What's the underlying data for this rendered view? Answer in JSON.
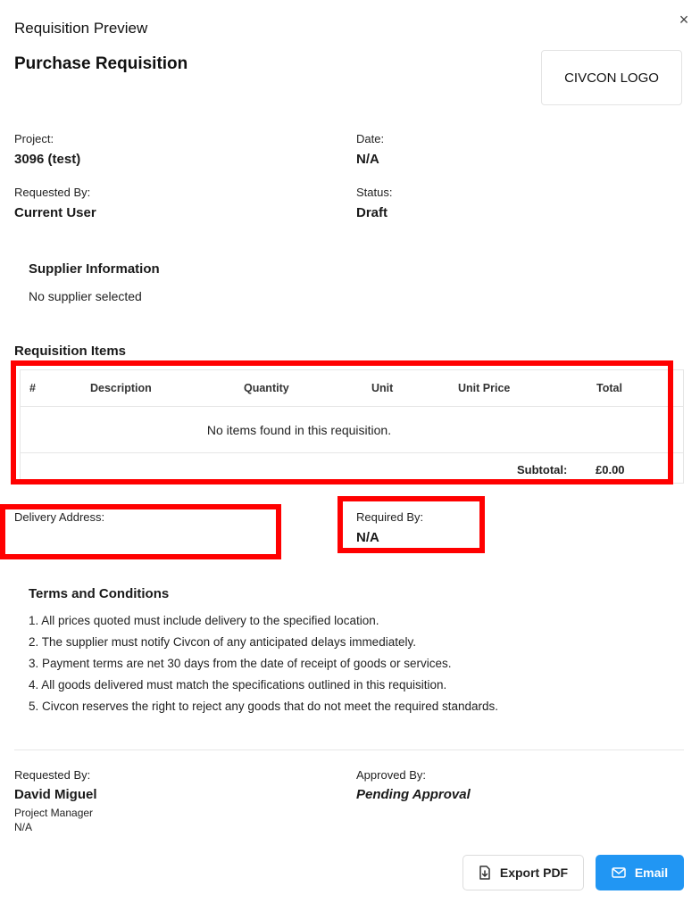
{
  "modal": {
    "title": "Requisition Preview",
    "close_glyph": "×"
  },
  "document": {
    "title": "Purchase Requisition",
    "logo_text": "CIVCON LOGO"
  },
  "info": {
    "project_label": "Project:",
    "project_value": "3096 (test)",
    "date_label": "Date:",
    "date_value": "N/A",
    "requested_by_label": "Requested By:",
    "requested_by_value": "Current User",
    "status_label": "Status:",
    "status_value": "Draft"
  },
  "supplier": {
    "heading": "Supplier Information",
    "text": "No supplier selected"
  },
  "items": {
    "heading": "Requisition Items",
    "columns": [
      "#",
      "Description",
      "Quantity",
      "Unit",
      "Unit Price",
      "Total"
    ],
    "empty_text": "No items found in this requisition.",
    "subtotal_label": "Subtotal:",
    "subtotal_value": "£0.00"
  },
  "delivery": {
    "address_label": "Delivery Address:",
    "address_value": "",
    "required_by_label": "Required By:",
    "required_by_value": "N/A"
  },
  "terms": {
    "heading": "Terms and Conditions",
    "items": [
      "1. All prices quoted must include delivery to the specified location.",
      "2. The supplier must notify Civcon of any anticipated delays immediately.",
      "3. Payment terms are net 30 days from the date of receipt of goods or services.",
      "4. All goods delivered must match the specifications outlined in this requisition.",
      "5. Civcon reserves the right to reject any goods that do not meet the required standards."
    ]
  },
  "signoff": {
    "requested_by_label": "Requested By:",
    "requested_by_name": "David Miguel",
    "requested_by_role": "Project Manager",
    "requested_by_extra": "N/A",
    "approved_by_label": "Approved By:",
    "approved_by_value": "Pending Approval"
  },
  "actions": {
    "export_pdf_label": "Export PDF",
    "email_label": "Email",
    "export_icon": "file-download-icon",
    "email_icon": "mail-icon"
  },
  "highlight_color": "#ff0000",
  "accent_color": "#2196f3"
}
